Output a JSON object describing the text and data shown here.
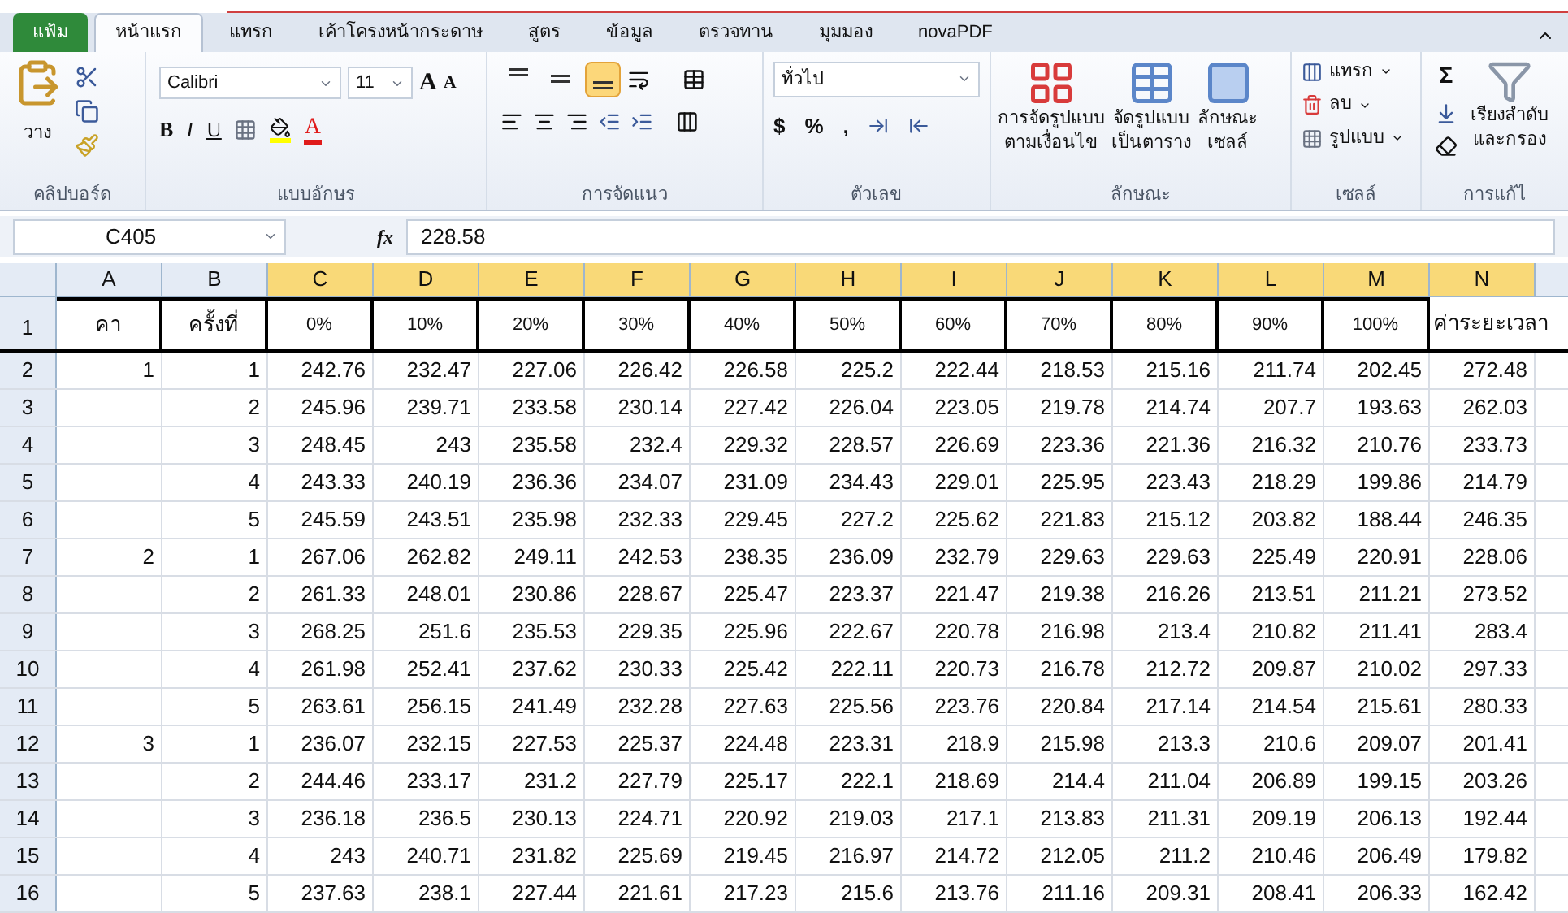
{
  "tabs": [
    {
      "label": "แฟ้ม",
      "kind": "file",
      "selected": false
    },
    {
      "label": "หน้าแรก",
      "kind": "tab",
      "selected": true
    },
    {
      "label": "แทรก",
      "kind": "tab",
      "selected": false
    },
    {
      "label": "เค้าโครงหน้ากระดาษ",
      "kind": "tab",
      "selected": false
    },
    {
      "label": "สูตร",
      "kind": "tab",
      "selected": false
    },
    {
      "label": "ข้อมูล",
      "kind": "tab",
      "selected": false
    },
    {
      "label": "ตรวจทาน",
      "kind": "tab",
      "selected": false
    },
    {
      "label": "มุมมอง",
      "kind": "tab",
      "selected": false
    },
    {
      "label": "novaPDF",
      "kind": "tab",
      "selected": false
    }
  ],
  "ribbon": {
    "clipboard": {
      "paste": "วาง",
      "label": "คลิปบอร์ด"
    },
    "font": {
      "name": "Calibri",
      "size": "11",
      "grow": "A",
      "shrink": "A",
      "bold": "B",
      "italic": "I",
      "underline": "U",
      "font_color_letter": "A",
      "label": "แบบอักษร"
    },
    "alignment": {
      "vertical": [
        {
          "selected": false
        },
        {
          "selected": false
        },
        {
          "selected": true
        }
      ],
      "label": "การจัดแนว"
    },
    "number": {
      "format": "ทั่วไป",
      "currency": "$",
      "percent": "%",
      "comma": ",",
      "label": "ตัวเลข"
    },
    "styles": {
      "buttons": [
        {
          "lines": [
            "การจัดรูปแบบ",
            "ตามเงื่อนไข"
          ]
        },
        {
          "lines": [
            "จัดรูปแบบ",
            "เป็นตาราง"
          ]
        },
        {
          "lines": [
            "ลักษณะ",
            "เซลล์"
          ]
        }
      ],
      "label": "ลักษณะ"
    },
    "cells": {
      "buttons": [
        "แทรก",
        "ลบ",
        "รูปแบบ"
      ],
      "label": "เซลล์"
    },
    "editing": {
      "sum": "Σ",
      "sort": [
        "เรียงลำดับ",
        "และกรอง"
      ],
      "label": "การแก้ไ"
    }
  },
  "formula_bar": {
    "name_box": "C405",
    "function_label": "fx",
    "value": "228.58"
  },
  "sheet": {
    "columns": [
      {
        "label": "A",
        "selected": false
      },
      {
        "label": "B",
        "selected": false
      },
      {
        "label": "C",
        "selected": true
      },
      {
        "label": "D",
        "selected": true
      },
      {
        "label": "E",
        "selected": true
      },
      {
        "label": "F",
        "selected": true
      },
      {
        "label": "G",
        "selected": true
      },
      {
        "label": "H",
        "selected": true
      },
      {
        "label": "I",
        "selected": true
      },
      {
        "label": "J",
        "selected": true
      },
      {
        "label": "K",
        "selected": true
      },
      {
        "label": "L",
        "selected": true
      },
      {
        "label": "M",
        "selected": true
      },
      {
        "label": "N",
        "selected": true
      }
    ],
    "header_row": {
      "number": "1",
      "cells": [
        "คา",
        "ครั้งที่",
        "0%",
        "10%",
        "20%",
        "30%",
        "40%",
        "50%",
        "60%",
        "70%",
        "80%",
        "90%",
        "100%",
        "ค่าระยะเวลา"
      ]
    },
    "rows": [
      {
        "number": "2",
        "a": "1",
        "b": "1",
        "values": [
          "242.76",
          "232.47",
          "227.06",
          "226.42",
          "226.58",
          "225.2",
          "222.44",
          "218.53",
          "215.16",
          "211.74",
          "202.45",
          "272.48"
        ]
      },
      {
        "number": "3",
        "b": "2",
        "values": [
          "245.96",
          "239.71",
          "233.58",
          "230.14",
          "227.42",
          "226.04",
          "223.05",
          "219.78",
          "214.74",
          "207.7",
          "193.63",
          "262.03"
        ]
      },
      {
        "number": "4",
        "b": "3",
        "values": [
          "248.45",
          "243",
          "235.58",
          "232.4",
          "229.32",
          "228.57",
          "226.69",
          "223.36",
          "221.36",
          "216.32",
          "210.76",
          "233.73"
        ]
      },
      {
        "number": "5",
        "b": "4",
        "values": [
          "243.33",
          "240.19",
          "236.36",
          "234.07",
          "231.09",
          "234.43",
          "229.01",
          "225.95",
          "223.43",
          "218.29",
          "199.86",
          "214.79"
        ]
      },
      {
        "number": "6",
        "b": "5",
        "values": [
          "245.59",
          "243.51",
          "235.98",
          "232.33",
          "229.45",
          "227.2",
          "225.62",
          "221.83",
          "215.12",
          "203.82",
          "188.44",
          "246.35"
        ]
      },
      {
        "number": "7",
        "a": "2",
        "b": "1",
        "values": [
          "267.06",
          "262.82",
          "249.11",
          "242.53",
          "238.35",
          "236.09",
          "232.79",
          "229.63",
          "229.63",
          "225.49",
          "220.91",
          "228.06"
        ]
      },
      {
        "number": "8",
        "b": "2",
        "values": [
          "261.33",
          "248.01",
          "230.86",
          "228.67",
          "225.47",
          "223.37",
          "221.47",
          "219.38",
          "216.26",
          "213.51",
          "211.21",
          "273.52"
        ]
      },
      {
        "number": "9",
        "b": "3",
        "values": [
          "268.25",
          "251.6",
          "235.53",
          "229.35",
          "225.96",
          "222.67",
          "220.78",
          "216.98",
          "213.4",
          "210.82",
          "211.41",
          "283.4"
        ]
      },
      {
        "number": "10",
        "b": "4",
        "values": [
          "261.98",
          "252.41",
          "237.62",
          "230.33",
          "225.42",
          "222.11",
          "220.73",
          "216.78",
          "212.72",
          "209.87",
          "210.02",
          "297.33"
        ]
      },
      {
        "number": "11",
        "b": "5",
        "values": [
          "263.61",
          "256.15",
          "241.49",
          "232.28",
          "227.63",
          "225.56",
          "223.76",
          "220.84",
          "217.14",
          "214.54",
          "215.61",
          "280.33"
        ]
      },
      {
        "number": "12",
        "a": "3",
        "b": "1",
        "values": [
          "236.07",
          "232.15",
          "227.53",
          "225.37",
          "224.48",
          "223.31",
          "218.9",
          "215.98",
          "213.3",
          "210.6",
          "209.07",
          "201.41"
        ]
      },
      {
        "number": "13",
        "b": "2",
        "values": [
          "244.46",
          "233.17",
          "231.2",
          "227.79",
          "225.17",
          "222.1",
          "218.69",
          "214.4",
          "211.04",
          "206.89",
          "199.15",
          "203.26"
        ]
      },
      {
        "number": "14",
        "b": "3",
        "values": [
          "236.18",
          "236.5",
          "230.13",
          "224.71",
          "220.92",
          "219.03",
          "217.1",
          "213.83",
          "211.31",
          "209.19",
          "206.13",
          "192.44"
        ]
      },
      {
        "number": "15",
        "b": "4",
        "values": [
          "243",
          "240.71",
          "231.82",
          "225.69",
          "219.45",
          "216.97",
          "214.72",
          "212.05",
          "211.2",
          "210.46",
          "206.49",
          "179.82"
        ]
      },
      {
        "number": "16",
        "b": "5",
        "values": [
          "237.63",
          "238.1",
          "227.44",
          "221.61",
          "217.23",
          "215.6",
          "213.76",
          "211.16",
          "209.31",
          "208.41",
          "206.33",
          "162.42"
        ]
      }
    ]
  }
}
